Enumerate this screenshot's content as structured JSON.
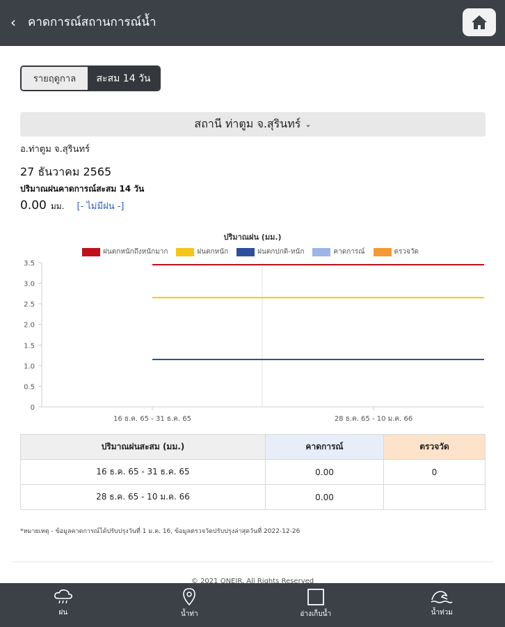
{
  "header": {
    "back_glyph": "‹",
    "title": "คาดการณ์สถานการณ์น้ำ",
    "home_icon": "home-icon"
  },
  "mode_toggle": {
    "options": [
      "รายฤดูกาล",
      "สะสม 14 วัน"
    ],
    "selected": "สะสม 14 วัน"
  },
  "station": {
    "label": "สถานี ท่าตูม จ.สุรินทร์",
    "chevron": "⌄"
  },
  "district": "อ.ท่าตูม จ.สุรินทร์",
  "date": "27 ธันวาคม 2565",
  "forecast_heading": "ปริมาณฝนคาดการณ์สะสม 14 วัน",
  "forecast_value": "0.00",
  "forecast_unit": "มม.",
  "forecast_status": "[- ไม่มีฝน -]",
  "chart_data": {
    "type": "line",
    "title": "ปริมาณฝน (มม.)",
    "categories": [
      "16 ธ.ค. 65 - 31 ธ.ค. 65",
      "28 ธ.ค. 65 - 10 ม.ค. 66"
    ],
    "ylim": [
      0,
      3.5
    ],
    "yticks": [
      "0",
      "0.5",
      "1.0",
      "1.5",
      "2.0",
      "2.5",
      "3.0",
      "3.5"
    ],
    "legend_position": "top",
    "series": [
      {
        "name": "ฝนตกหนักถึงหนักมาก",
        "color": "#c0101a",
        "values": [
          3.45,
          3.45
        ]
      },
      {
        "name": "ฝนตกหนัก",
        "color": "#f5c518",
        "values": [
          2.65,
          2.65
        ]
      },
      {
        "name": "ฝนตกปกติ-หนัก",
        "color": "#2d4f9c",
        "values": [
          1.15,
          1.15
        ]
      },
      {
        "name": "คาดการณ์",
        "color": "#9db6e6",
        "values": []
      },
      {
        "name": "ตรวจวัด",
        "color": "#f39a35",
        "values": []
      }
    ]
  },
  "table": {
    "headers": [
      "ปริมาณฝนสะสม (มม.)",
      "คาดการณ์",
      "ตรวจวัด"
    ],
    "rows": [
      [
        "16 ธ.ค. 65 - 31 ธ.ค. 65",
        "0.00",
        "0"
      ],
      [
        "28 ธ.ค. 65 - 10 ม.ค. 66",
        "0.00",
        ""
      ]
    ]
  },
  "footnote": "*หมายเหตุ - ข้อมูลคาดการณ์ได้ปรับปรุงวันที่ 1 ม.ค. 16, ข้อมูลตรวจวัดปรับปรุงล่าสุดวันที่ 2022-12-26",
  "copyright": "© 2021 ONEIR. All Rights Reserved",
  "bottom_nav": [
    {
      "label": "ฝน",
      "icon": "rain-cloud-icon"
    },
    {
      "label": "น้ำท่า",
      "icon": "map-pin-icon"
    },
    {
      "label": "อ่างเก็บน้ำ",
      "icon": "reservoir-square-icon"
    },
    {
      "label": "น้ำท่วม",
      "icon": "flood-wave-icon"
    }
  ]
}
